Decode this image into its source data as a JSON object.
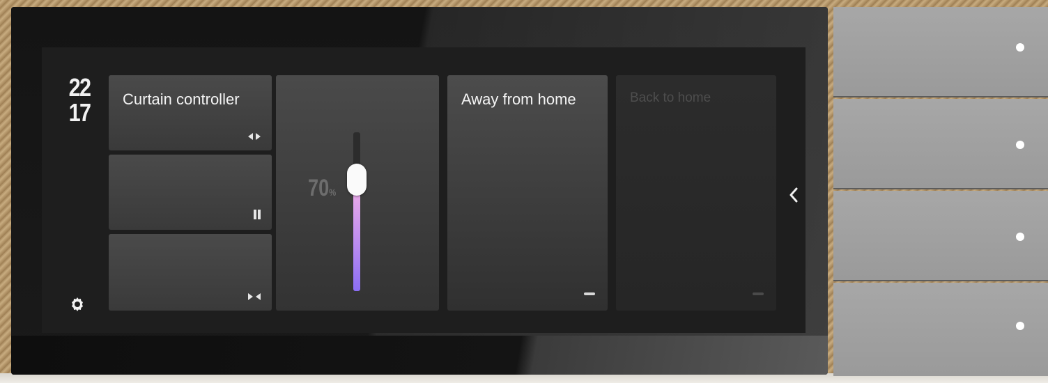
{
  "clock": {
    "hours": "22",
    "minutes": "17"
  },
  "tiles": {
    "curtain": {
      "label": "Curtain controller",
      "icon": "open-curtain-icon"
    },
    "pause": {
      "icon": "pause-icon"
    },
    "close": {
      "icon": "close-curtain-icon"
    }
  },
  "slider": {
    "value": 0.7,
    "label": "70",
    "unit": "%"
  },
  "scenes": [
    {
      "label": "Away from home",
      "state": "active",
      "indicator": "dash-icon"
    },
    {
      "label": "Back to home",
      "state": "inactive",
      "indicator": "dash-icon"
    }
  ],
  "icons": {
    "settings": "gear-icon",
    "back": "chevron-left-icon"
  },
  "colors": {
    "slider_gradient_top": "#f4b0e6",
    "slider_gradient_bottom": "#8b6ef5",
    "led": "#ffffff"
  },
  "physical_keys": [
    {
      "name": "key-1"
    },
    {
      "name": "key-2"
    },
    {
      "name": "key-3"
    },
    {
      "name": "key-4"
    }
  ]
}
